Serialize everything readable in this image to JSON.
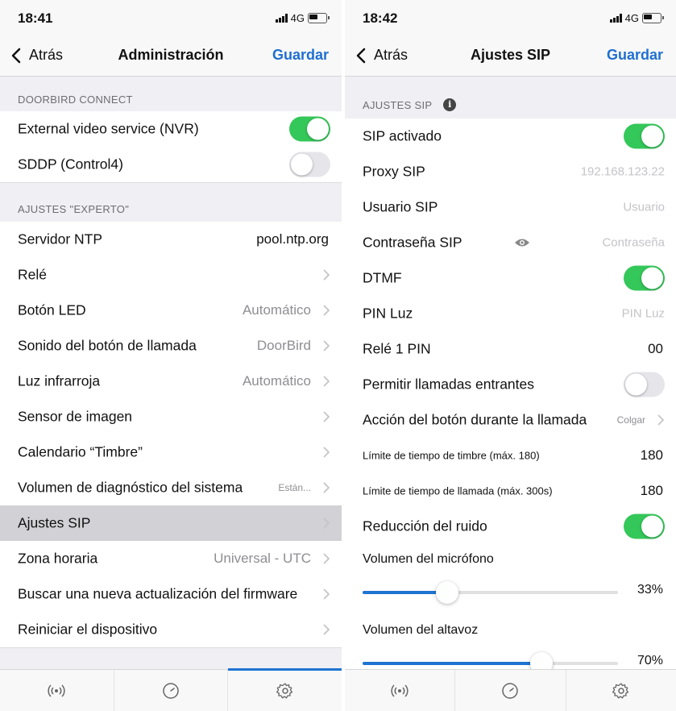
{
  "left": {
    "status": {
      "time": "18:41",
      "network": "4G"
    },
    "nav": {
      "back": "Atrás",
      "title": "Administración",
      "save": "Guardar"
    },
    "sections": [
      {
        "header": "DOORBIRD CONNECT"
      },
      {
        "header": "AJUSTES \"EXPERTO\""
      }
    ],
    "rows": [
      {
        "label": "External video service (NVR)",
        "toggle": true
      },
      {
        "label": "SDDP (Control4)",
        "toggle": false
      },
      {
        "label": "Servidor NTP",
        "value": "pool.ntp.org"
      },
      {
        "label": "Relé"
      },
      {
        "label": "Botón LED",
        "value": "Automático"
      },
      {
        "label": "Sonido del botón de llamada",
        "value": "DoorBird"
      },
      {
        "label": "Luz infrarroja",
        "value": "Automático"
      },
      {
        "label": "Sensor de imagen"
      },
      {
        "label": "Calendario “Timbre”"
      },
      {
        "label": "Volumen de diagnóstico del sistema",
        "value": "Están..."
      },
      {
        "label": "Ajustes SIP",
        "selected": true
      },
      {
        "label": "Zona horaria",
        "value": "Universal - UTC"
      },
      {
        "label": "Buscar una nueva actualización del firmware"
      },
      {
        "label": "Reiniciar el dispositivo"
      }
    ]
  },
  "right": {
    "status": {
      "time": "18:42",
      "network": "4G"
    },
    "nav": {
      "back": "Atrás",
      "title": "Ajustes SIP",
      "save": "Guardar"
    },
    "section_header": "AJUSTES SIP",
    "info_icon": "i",
    "rows": [
      {
        "label": "SIP activado",
        "toggle": true
      },
      {
        "label": "Proxy SIP",
        "placeholder": "192.168.123.22"
      },
      {
        "label": "Usuario SIP",
        "placeholder": "Usuario"
      },
      {
        "label": "Contraseña SIP",
        "placeholder": "Contraseña"
      },
      {
        "label": "DTMF",
        "toggle": true
      },
      {
        "label": "PIN Luz",
        "placeholder": "PIN Luz"
      },
      {
        "label": "Relé 1 PIN",
        "value": "00"
      },
      {
        "label": "Permitir llamadas entrantes",
        "toggle": false
      },
      {
        "label": "Acción del botón durante la llamada",
        "value": "Colgar"
      },
      {
        "label": "Límite de tiempo de timbre (máx. 180)",
        "value": "180"
      },
      {
        "label": "Límite de tiempo de llamada (máx. 300s)",
        "value": "180"
      },
      {
        "label": "Reducción del ruido",
        "toggle": true
      }
    ],
    "sliders": [
      {
        "label": "Volumen del micrófono",
        "value": 0.33,
        "display": "33%"
      },
      {
        "label": "Volumen del altavoz",
        "value": 0.7,
        "display": "70%"
      }
    ]
  },
  "tabs": [
    {
      "icon": "broadcast-icon"
    },
    {
      "icon": "clock-icon"
    },
    {
      "icon": "gear-icon",
      "active": true
    }
  ],
  "colors": {
    "accent": "#1f6fd1",
    "toggle_on": "#34c759"
  }
}
